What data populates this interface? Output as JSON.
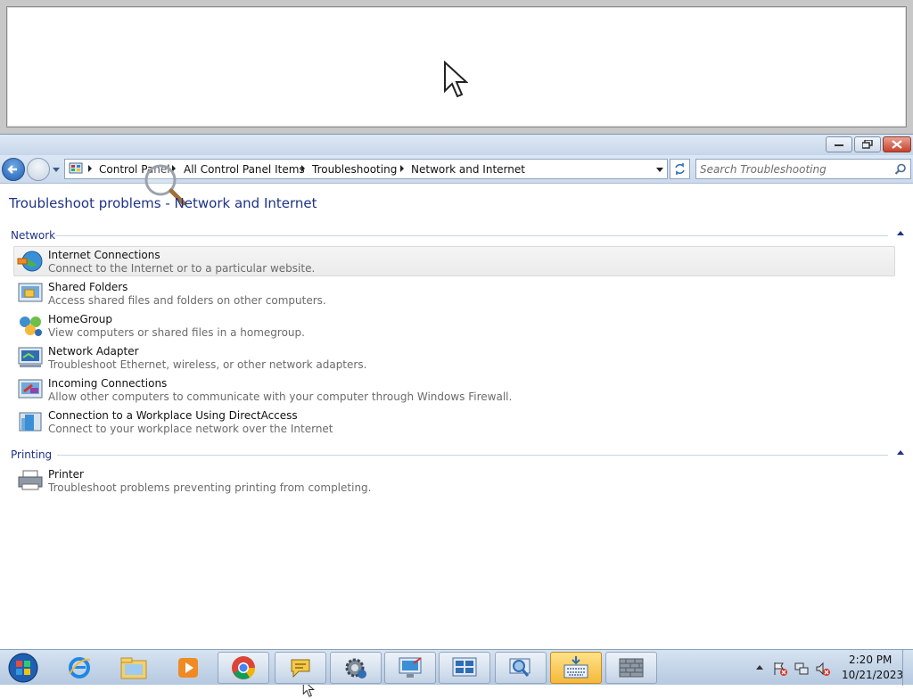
{
  "address_bar": {
    "crumbs": [
      "Control Panel",
      "All Control Panel Items",
      "Troubleshooting",
      "Network and Internet"
    ]
  },
  "search": {
    "placeholder": "Search Troubleshooting"
  },
  "page": {
    "title": "Troubleshoot problems - Network and Internet"
  },
  "groups": [
    {
      "label": "Network",
      "items": [
        {
          "title": "Internet Connections",
          "desc": "Connect to the Internet or to a particular website.",
          "icon": "globe-network-icon"
        },
        {
          "title": "Shared Folders",
          "desc": "Access shared files and folders on other computers.",
          "icon": "shared-folder-icon"
        },
        {
          "title": "HomeGroup",
          "desc": "View computers or shared files in a homegroup.",
          "icon": "homegroup-icon"
        },
        {
          "title": "Network Adapter",
          "desc": "Troubleshoot Ethernet, wireless, or other network adapters.",
          "icon": "network-adapter-icon"
        },
        {
          "title": "Incoming Connections",
          "desc": "Allow other computers to communicate with your computer through Windows Firewall.",
          "icon": "incoming-connections-icon"
        },
        {
          "title": "Connection to a Workplace Using DirectAccess",
          "desc": "Connect to your workplace network over the Internet",
          "icon": "directaccess-icon"
        }
      ]
    },
    {
      "label": "Printing",
      "items": [
        {
          "title": "Printer",
          "desc": "Troubleshoot problems preventing printing from completing.",
          "icon": "printer-icon"
        }
      ]
    }
  ],
  "taskbar": {
    "buttons": [
      "internet-explorer-icon",
      "file-explorer-icon",
      "media-player-icon",
      "chrome-icon",
      "speech-bubble-icon",
      "settings-gear-icon",
      "remote-desktop-icon",
      "control-panel-icon",
      "magnifier-tool-icon",
      "on-screen-keyboard-icon",
      "firewall-wall-icon"
    ]
  },
  "clock": {
    "time": "2:20 PM",
    "date": "10/21/2023"
  },
  "colors": {
    "title_blue": "#1e3287",
    "taskbar_active": "#f5b83a",
    "close_red": "#c7412c"
  }
}
